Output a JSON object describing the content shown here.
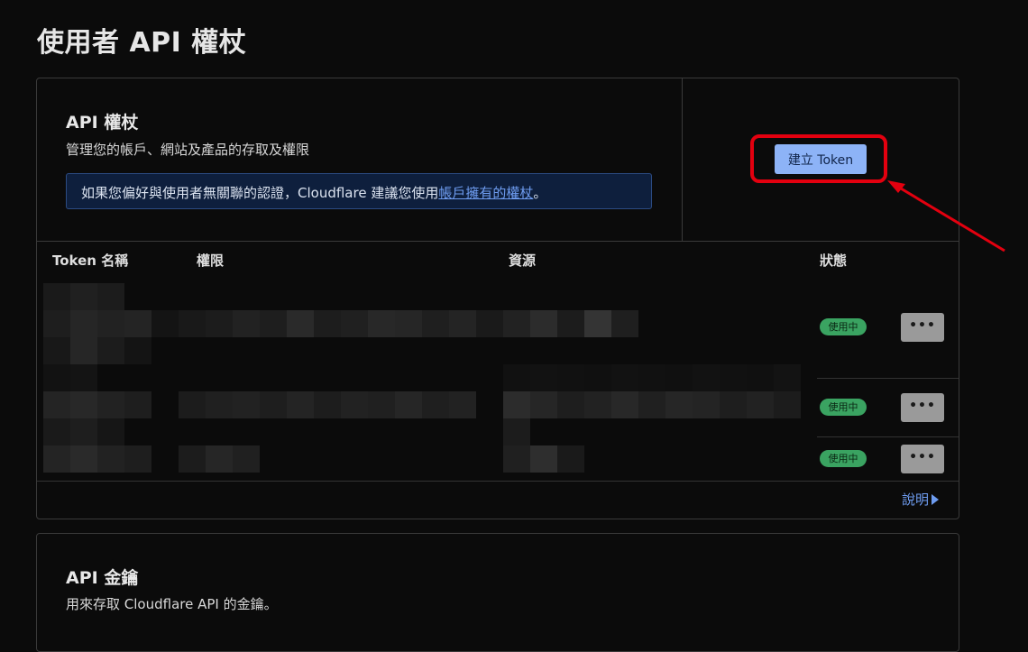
{
  "page": {
    "title": "使用者 API 權杖"
  },
  "tokens_card": {
    "title": "API 權杖",
    "description": "管理您的帳戶、網站及產品的存取及權限",
    "info_text": "如果您偏好與使用者無關聯的認證，Cloudflare 建議您使用",
    "info_link": "帳戶擁有的權杖",
    "info_suffix": "。",
    "create_button": "建立 Token",
    "columns": {
      "name": "Token 名稱",
      "permissions": "權限",
      "resources": "資源",
      "status": "狀態"
    },
    "rows": [
      {
        "status": "使用中",
        "more": "•••"
      },
      {
        "status": "使用中",
        "more": "•••"
      },
      {
        "status": "使用中",
        "more": "•••"
      }
    ],
    "help_link": "說明"
  },
  "keys_card": {
    "title": "API 金鑰",
    "description": "用來存取 Cloudflare API 的金鑰。"
  },
  "colors": {
    "accent": "#8db3f7",
    "link": "#6e9cf0",
    "badge": "#3aa361",
    "highlight": "#e3000f"
  }
}
